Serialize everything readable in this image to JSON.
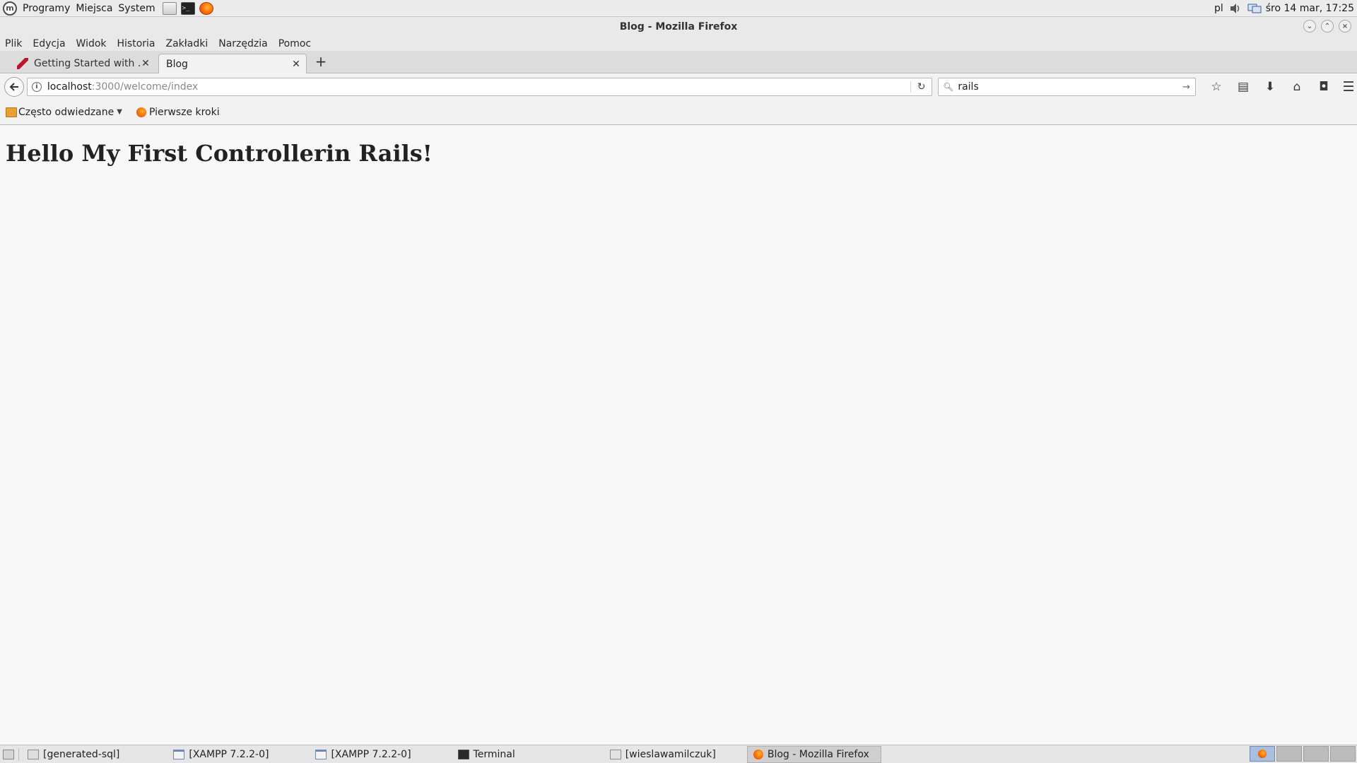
{
  "panel": {
    "menus": [
      "Programy",
      "Miejsca",
      "System"
    ],
    "keyboard_layout": "pl",
    "clock": "śro 14 mar, 17:25"
  },
  "window": {
    "title": "Blog - Mozilla Firefox"
  },
  "menubar": {
    "items": [
      "Plik",
      "Edycja",
      "Widok",
      "Historia",
      "Zakładki",
      "Narzędzia",
      "Pomoc"
    ]
  },
  "tabs": [
    {
      "label": "Getting Started with ...",
      "favicon": "rails-icon",
      "active": false
    },
    {
      "label": "Blog",
      "favicon": "",
      "active": true
    }
  ],
  "navbar": {
    "url_host": "localhost",
    "url_path": ":3000/welcome/index",
    "search_value": "rails"
  },
  "bookmarks": [
    {
      "label": "Często odwiedzane",
      "icon": "folder-icon",
      "has_menu": true
    },
    {
      "label": "Pierwsze kroki",
      "icon": "firefox-icon",
      "has_menu": false
    }
  ],
  "page": {
    "heading": "Hello My First Controllerin Rails!"
  },
  "taskbar": {
    "items": [
      {
        "label": "[generated-sql]",
        "icon": "folder-icon",
        "active": false
      },
      {
        "label": "[XAMPP 7.2.2-0]",
        "icon": "window-icon",
        "active": false
      },
      {
        "label": "[XAMPP 7.2.2-0]",
        "icon": "window-icon",
        "active": false
      },
      {
        "label": "Terminal",
        "icon": "terminal-icon",
        "active": false
      },
      {
        "label": "[wieslawamilczuk]",
        "icon": "home-folder-icon",
        "active": false
      },
      {
        "label": "Blog - Mozilla Firefox",
        "icon": "firefox-icon",
        "active": true
      }
    ]
  }
}
